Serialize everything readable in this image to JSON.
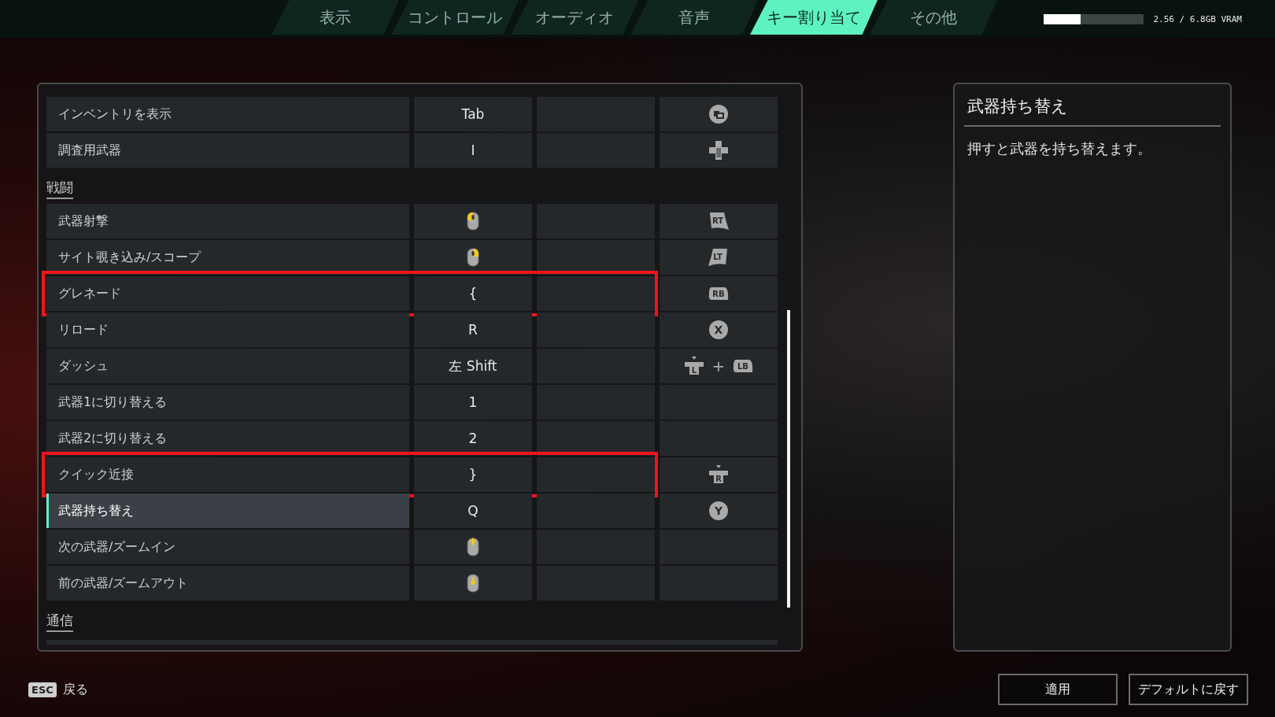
{
  "tabs": [
    {
      "label": "表示",
      "selected": false
    },
    {
      "label": "コントロール",
      "selected": false
    },
    {
      "label": "オーディオ",
      "selected": false
    },
    {
      "label": "音声",
      "selected": false
    },
    {
      "label": "キー割り当て",
      "selected": true
    },
    {
      "label": "その他",
      "selected": false
    }
  ],
  "vram": {
    "level": 0.37,
    "reading": "2.56 / 6.8GB VRAM"
  },
  "bindings": [
    {
      "kind": "row",
      "action": "インベントリを表示",
      "selected": false,
      "highlighted": false,
      "key_1": {
        "kind": "text",
        "label": "Tab"
      },
      "pad": [
        {
          "kind": "view"
        }
      ]
    },
    {
      "kind": "row",
      "action": "調査用武器",
      "selected": false,
      "highlighted": false,
      "key_1": {
        "kind": "text",
        "label": "I"
      },
      "pad": [
        {
          "kind": "dpad"
        }
      ]
    },
    {
      "kind": "section",
      "title": "戦闘"
    },
    {
      "kind": "row",
      "action": "武器射撃",
      "selected": false,
      "highlighted": false,
      "key_1": {
        "kind": "mouse_left"
      },
      "pad": [
        {
          "kind": "trigger_right",
          "label": "RT"
        }
      ]
    },
    {
      "kind": "row",
      "action": "サイト覗き込み/スコープ",
      "selected": false,
      "highlighted": false,
      "key_1": {
        "kind": "mouse_right"
      },
      "pad": [
        {
          "kind": "trigger_left",
          "label": "LT"
        }
      ]
    },
    {
      "kind": "row",
      "action": "グレネード",
      "selected": false,
      "highlighted": true,
      "key_1": {
        "kind": "text",
        "label": "{"
      },
      "pad": [
        {
          "kind": "bumper",
          "label": "RB"
        }
      ]
    },
    {
      "kind": "row",
      "action": "リロード",
      "selected": false,
      "highlighted": false,
      "key_1": {
        "kind": "text",
        "label": "R"
      },
      "pad": [
        {
          "kind": "face",
          "label": "X"
        }
      ]
    },
    {
      "kind": "row",
      "action": "ダッシュ",
      "selected": false,
      "highlighted": false,
      "key_1": {
        "kind": "text",
        "label": "左 Shift"
      },
      "pad": [
        {
          "kind": "stick",
          "label": "L"
        },
        {
          "kind": "plus",
          "label": "+"
        },
        {
          "kind": "bumper",
          "label": "LB"
        }
      ]
    },
    {
      "kind": "row",
      "action": "武器1に切り替える",
      "selected": false,
      "highlighted": false,
      "key_1": {
        "kind": "text",
        "label": "1"
      }
    },
    {
      "kind": "row",
      "action": "武器2に切り替える",
      "selected": false,
      "highlighted": false,
      "key_1": {
        "kind": "text",
        "label": "2"
      }
    },
    {
      "kind": "row",
      "action": "クイック近接",
      "selected": false,
      "highlighted": true,
      "key_1": {
        "kind": "text",
        "label": "}"
      },
      "pad": [
        {
          "kind": "stick",
          "label": "R"
        }
      ]
    },
    {
      "kind": "row",
      "action": "武器持ち替え",
      "selected": true,
      "highlighted": false,
      "key_1": {
        "kind": "text",
        "label": "Q"
      },
      "pad": [
        {
          "kind": "face",
          "label": "Y"
        }
      ]
    },
    {
      "kind": "row",
      "action": "次の武器/ズームイン",
      "selected": false,
      "highlighted": false,
      "key_1": {
        "kind": "wheel_up"
      }
    },
    {
      "kind": "row",
      "action": "前の武器/ズームアウト",
      "selected": false,
      "highlighted": false,
      "key_1": {
        "kind": "wheel_down"
      }
    },
    {
      "kind": "section",
      "title": "通信"
    }
  ],
  "detail": {
    "title": "武器持ち替え",
    "description": "押すと武器を持ち替えます。"
  },
  "footer": {
    "back_key": "ESC",
    "back_label": "戻る",
    "buttons": [
      "適用",
      "デフォルトに戻す"
    ]
  }
}
